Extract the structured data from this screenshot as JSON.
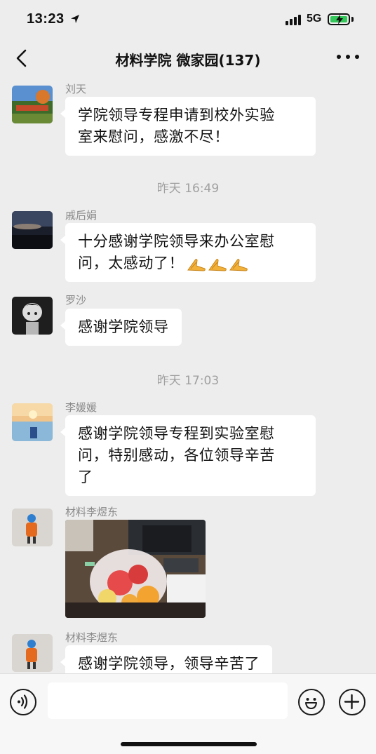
{
  "status_bar": {
    "time": "13:23",
    "network": "5G",
    "location_icon": "location-arrow-icon",
    "battery_color": "#34c759"
  },
  "header": {
    "title": "材料学院 微家园(137)",
    "back_icon": "chevron-left-icon",
    "more_icon": "more-dots-icon"
  },
  "messages": [
    {
      "type": "text",
      "sender": "刘天",
      "lines": [
        "学院领导专程申请到校外实验",
        "室来慰问，感激不尽！"
      ]
    },
    {
      "type": "time",
      "text": "昨天 16:49"
    },
    {
      "type": "text",
      "sender": "戚后娟",
      "lines": [
        "十分感谢学院领导来办公室慰",
        "问，太感动了！"
      ],
      "emoji": "praying-hands-icon",
      "emoji_count": 3
    },
    {
      "type": "text",
      "sender": "罗沙",
      "lines": [
        "感谢学院领导"
      ]
    },
    {
      "type": "time",
      "text": "昨天 17:03"
    },
    {
      "type": "text",
      "sender": "李媛媛",
      "lines": [
        "感谢学院领导专程到实验室慰",
        "问，特别感动，各位领导辛苦",
        "了"
      ]
    },
    {
      "type": "image",
      "sender": "材料李煜东",
      "image": "gift-fruit-bag-photo"
    },
    {
      "type": "text",
      "sender": "材料李煜东",
      "lines": [
        "感谢学院领导，领导辛苦了"
      ]
    }
  ],
  "input_bar": {
    "voice_icon": "voice-icon",
    "emoji_icon": "emoji-smile-icon",
    "plus_icon": "plus-icon",
    "text_value": ""
  }
}
